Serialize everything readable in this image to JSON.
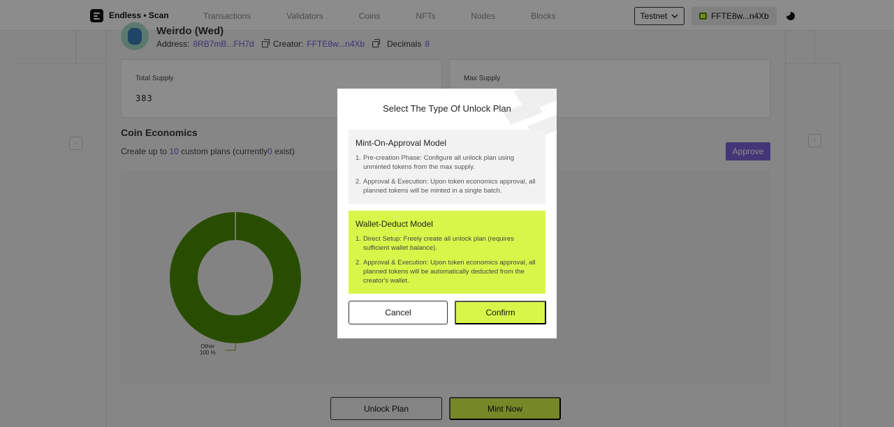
{
  "header": {
    "brand": "Endless • Scan",
    "nav": [
      "Transactions",
      "Validators",
      "Coins",
      "NFTs",
      "Nodes",
      "Blocks"
    ],
    "network": "Testnet",
    "wallet": "FFTE8w...n4Xb"
  },
  "coin": {
    "name": "Weirdo (Wed)",
    "address_label": "Address:",
    "address": "8RB7mB...FH7d",
    "creator_label": "Creator:",
    "creator": "FFTE8w...n4Xb",
    "decimals_label": "Decimals",
    "decimals": "8"
  },
  "cards": {
    "total_supply_label": "Total Supply",
    "total_supply": "383",
    "max_supply_label": "Max Supply"
  },
  "economics": {
    "title": "Coin Economics",
    "sub_prefix": "Create up to",
    "max_plans": "10",
    "sub_mid": "custom plans (currently",
    "current": "0",
    "sub_suffix": "exist)",
    "approve": "Approve"
  },
  "chart_data": {
    "type": "pie",
    "style": "donut",
    "slices": [
      {
        "label": "Other",
        "percent_text": "100 %",
        "value": 100,
        "color": "#4c8c00"
      }
    ]
  },
  "actions": {
    "unlock_plan": "Unlock Plan",
    "mint_now": "Mint Now"
  },
  "modal": {
    "title": "Select The Type Of Unlock Plan",
    "option_a": {
      "title": "Mint-On-Approval Model",
      "items": [
        "Pre-creation Phase: Configure all unlock plan using unminted tokens from the max supply.",
        "Approval & Execution: Upon token economics approval, all planned tokens will be minted in a single batch."
      ]
    },
    "option_b": {
      "title": "Wallet-Deduct Model",
      "items": [
        "Direct Setup: Freely create all unlock plan (requires sufficient wallet balance).",
        "Approval & Execution: Upon token economics approval, all planned tokens will be automatically deducted from the creator's wallet."
      ]
    },
    "cancel": "Cancel",
    "confirm": "Confirm"
  },
  "colors": {
    "accent_green": "#d8f64a",
    "accent_purple": "#7b63d9",
    "link": "#6b5bd6",
    "donut": "#4c8c00"
  }
}
